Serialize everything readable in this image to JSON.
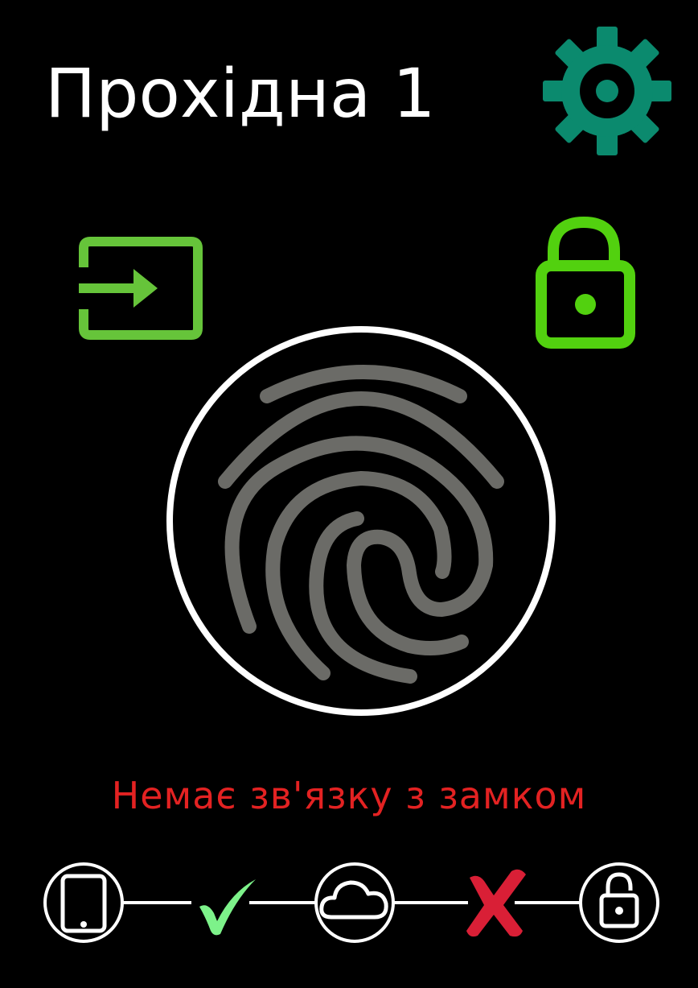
{
  "header": {
    "title": "Прохідна 1"
  },
  "icons": {
    "settings": "gear-icon",
    "entry_mode": "login-arrow-icon",
    "lock_state": "unlocked-padlock-icon",
    "scanner": "fingerprint-icon"
  },
  "status": {
    "message": "Немає зв'язку з замком"
  },
  "connection_chain": {
    "nodes": [
      "device",
      "cloud",
      "lock"
    ],
    "links": [
      {
        "from": "device",
        "to": "cloud",
        "state": "ok",
        "symbol": "✔"
      },
      {
        "from": "cloud",
        "to": "lock",
        "state": "error",
        "symbol": "✘"
      }
    ]
  },
  "colors": {
    "background": "#000000",
    "title": "#ffffff",
    "gear": "#0b8a6e",
    "entry_icon": "#66c43a",
    "lock_icon": "#52d10f",
    "fingerprint": "#6b6b67",
    "ring": "#ffffff",
    "status_error": "#e32222",
    "link_ok": "#7df28a",
    "link_error": "#d91f36"
  }
}
